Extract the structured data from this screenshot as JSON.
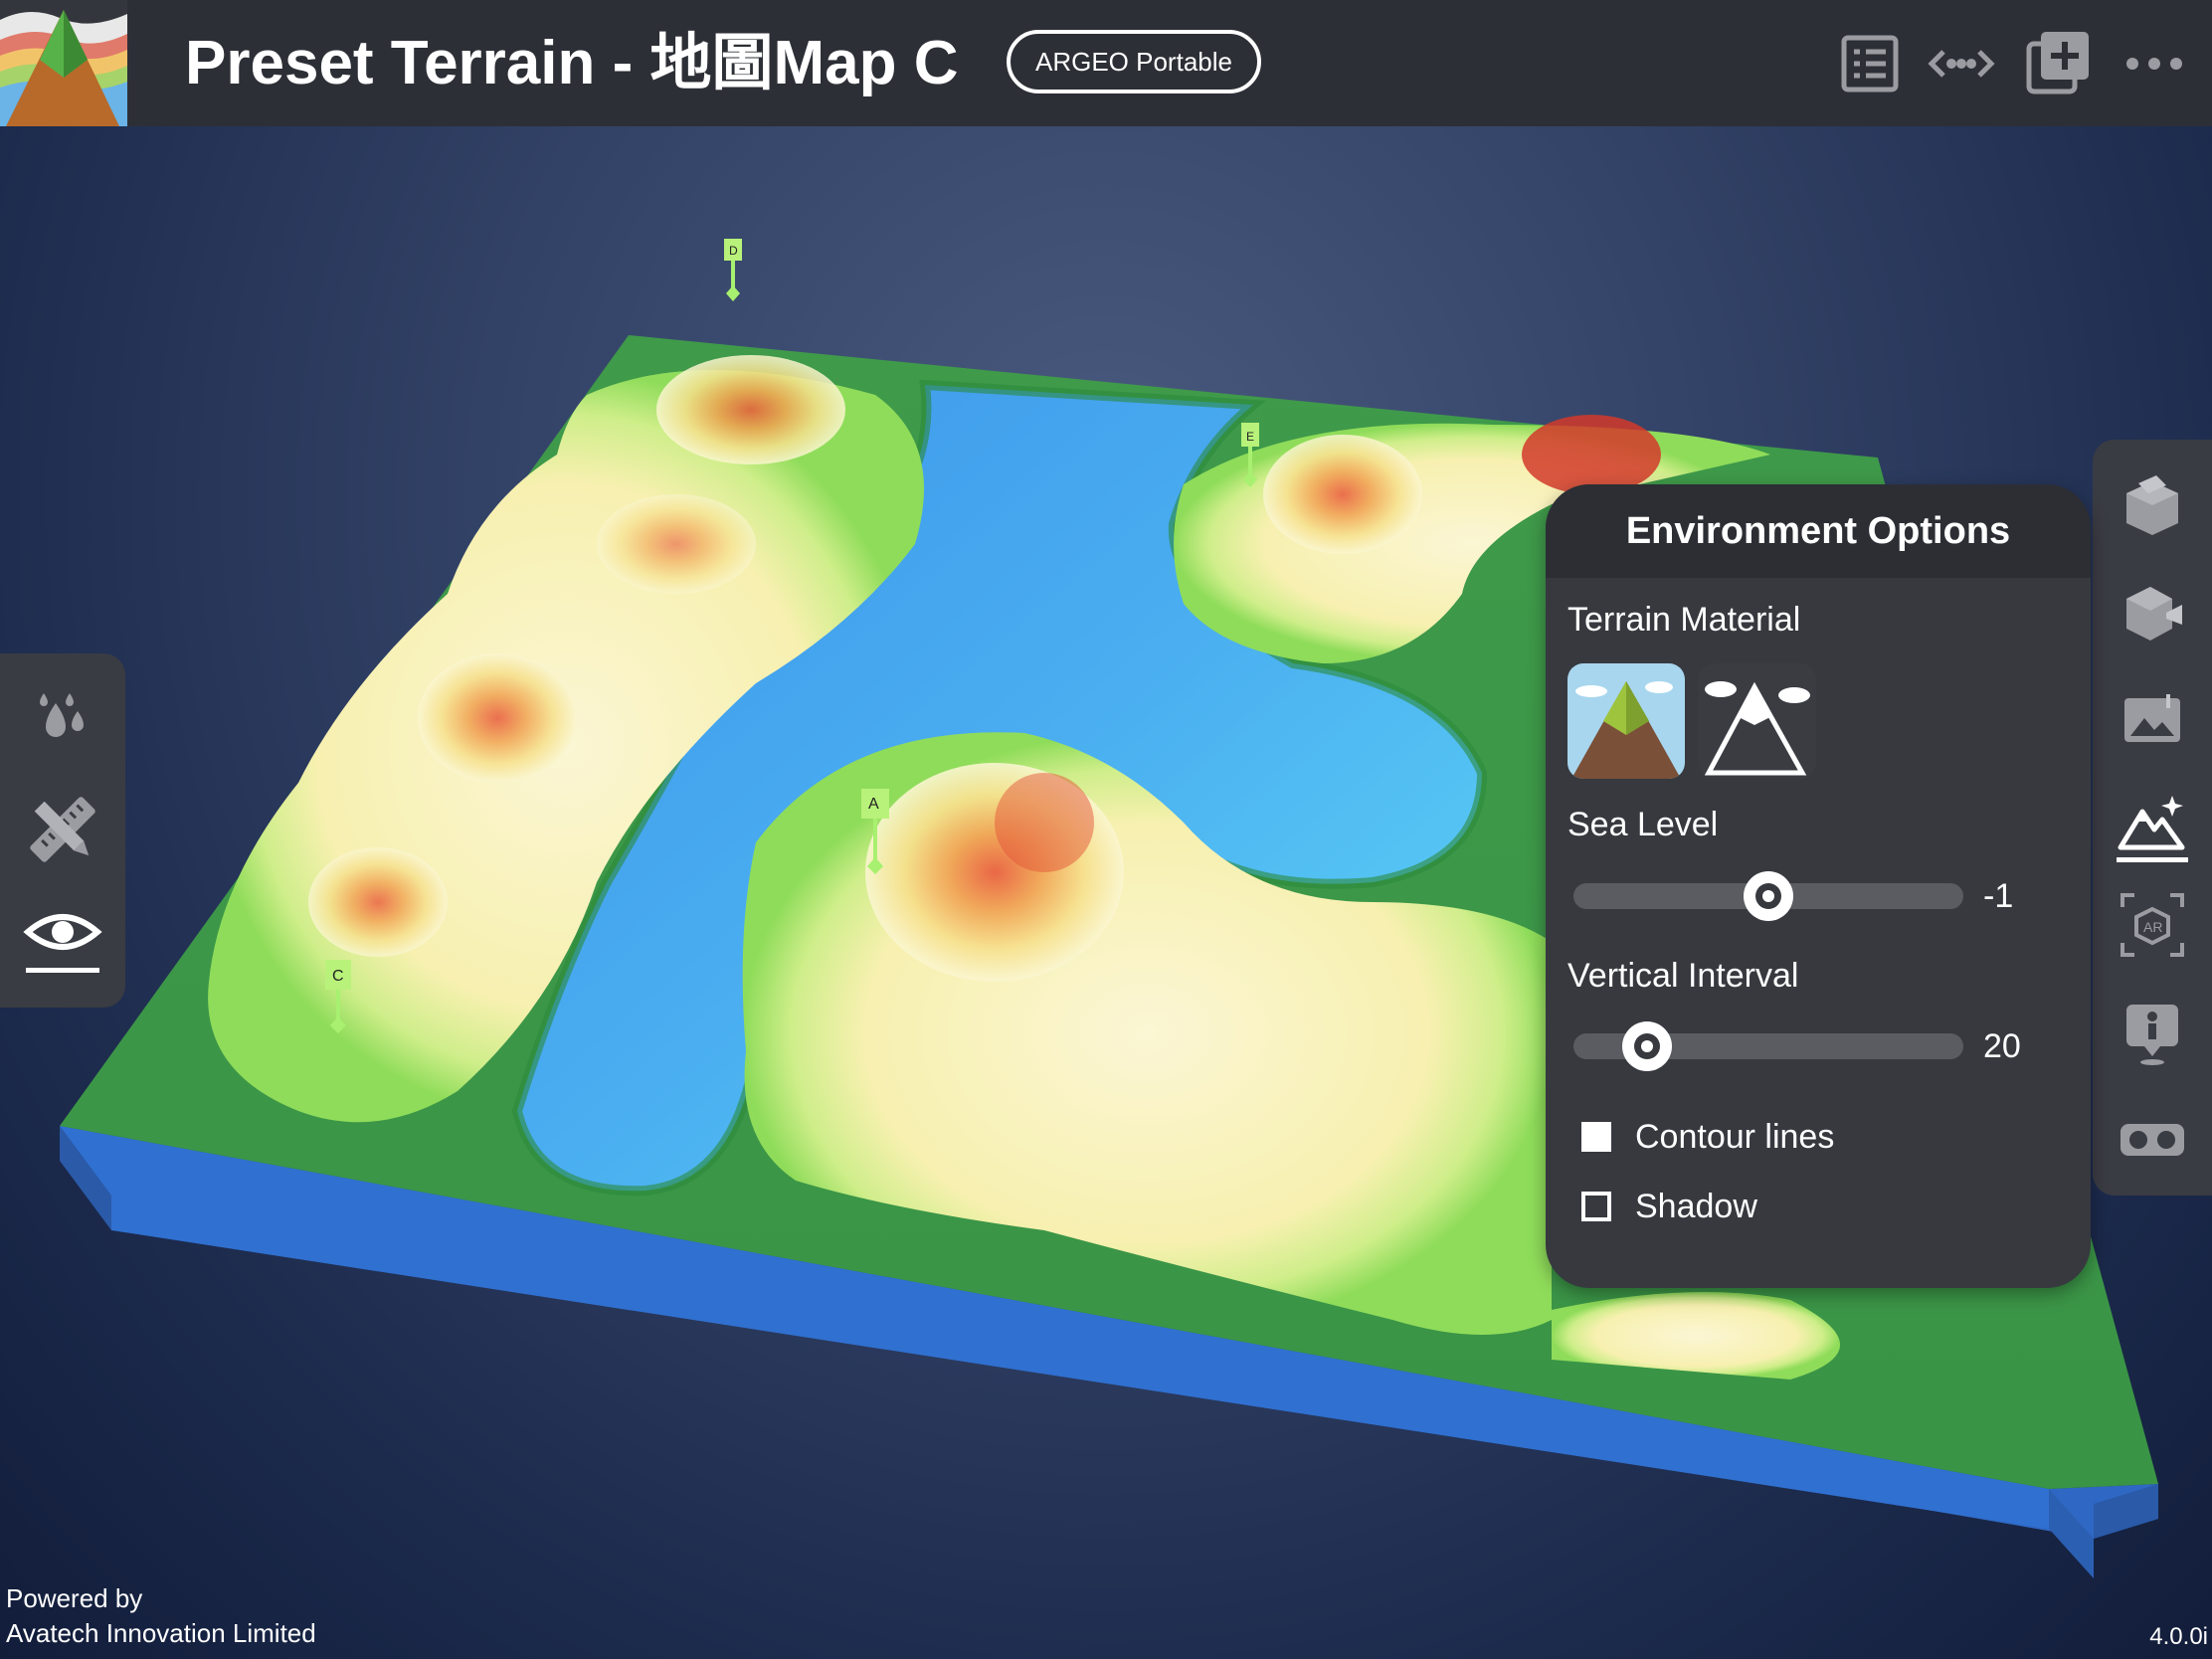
{
  "header": {
    "title": "Preset Terrain - 地圖Map C",
    "badge": "ARGEO Portable",
    "icons": [
      "list-icon",
      "code-arrows-icon",
      "add-layer-icon",
      "more-icon"
    ]
  },
  "map": {
    "markers": [
      {
        "id": "A",
        "label": "A"
      },
      {
        "id": "C",
        "label": "C"
      },
      {
        "id": "D",
        "label": "D"
      },
      {
        "id": "E",
        "label": "E"
      }
    ]
  },
  "left_toolbar": {
    "items": [
      "water-drops-icon",
      "ruler-pencil-icon",
      "eye-icon"
    ],
    "active": "eye-icon"
  },
  "right_toolbar": {
    "items": [
      "box-open-icon",
      "box-camera-icon",
      "photo-icon",
      "terrain-sparkle-icon",
      "ar-frame-icon",
      "person-marker-icon",
      "vr-goggles-icon"
    ],
    "active": "terrain-sparkle-icon"
  },
  "environment": {
    "title": "Environment Options",
    "terrain_material_label": "Terrain Material",
    "materials": [
      "color-mountain-material",
      "mono-mountain-material"
    ],
    "sea_level_label": "Sea Level",
    "sea_level_value": "-1",
    "sea_level_fraction": 0.5,
    "vertical_interval_label": "Vertical Interval",
    "vertical_interval_value": "20",
    "vertical_interval_fraction": 0.19,
    "contour_label": "Contour lines",
    "contour_checked": true,
    "shadow_label": "Shadow",
    "shadow_checked": false
  },
  "footer": {
    "line1": "Powered by",
    "line2": "Avatech Innovation Limited",
    "version": "4.0.0i"
  },
  "colors": {
    "bar": "#2d2f36",
    "panel": "#37393f",
    "water": "#3a90e8",
    "land": "#3f9a4a"
  }
}
